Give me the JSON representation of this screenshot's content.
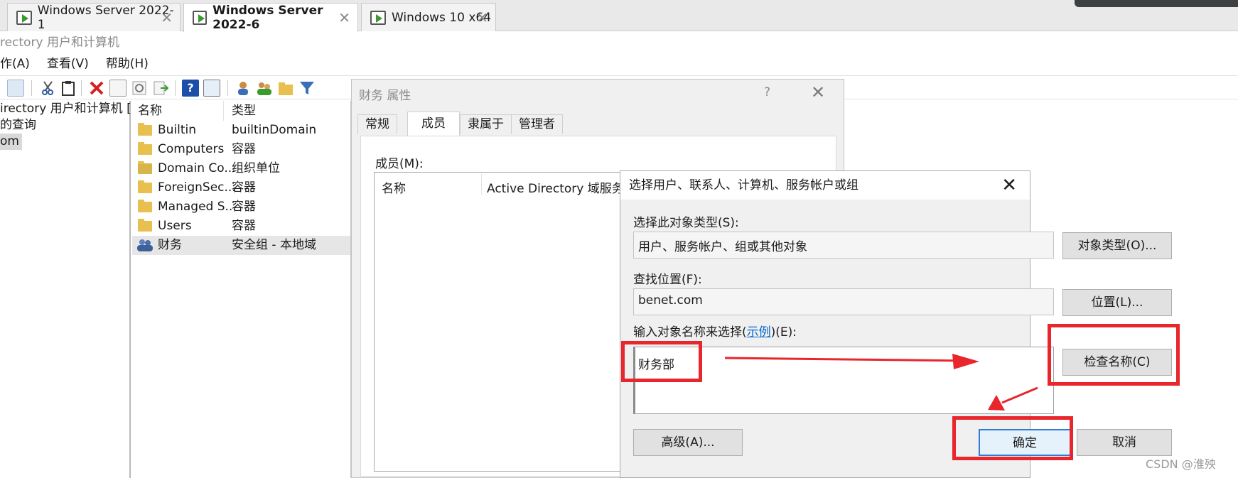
{
  "vm_tabs": [
    {
      "label": "Windows Server 2022-1",
      "active": false
    },
    {
      "label": "Windows Server 2022-6",
      "active": true
    },
    {
      "label": "Windows 10 x64",
      "active": false
    }
  ],
  "tab_close_glyph": "✕",
  "app_title": "rectory 用户和计算机",
  "menu": [
    "作(A)",
    "查看(V)",
    "帮助(H)"
  ],
  "tree": {
    "items": [
      "irectory 用户和计算机 [",
      "的查询",
      "om"
    ]
  },
  "list": {
    "columns": {
      "name": "名称",
      "type": "类型"
    },
    "rows": [
      {
        "name": "Builtin",
        "type": "builtinDomain",
        "icon": "folder-icon"
      },
      {
        "name": "Computers",
        "type": "容器",
        "icon": "folder-icon"
      },
      {
        "name": "Domain Co...",
        "type": "组织单位",
        "icon": "ou-folder-icon"
      },
      {
        "name": "ForeignSec...",
        "type": "容器",
        "icon": "folder-icon"
      },
      {
        "name": "Managed S...",
        "type": "容器",
        "icon": "folder-icon"
      },
      {
        "name": "Users",
        "type": "容器",
        "icon": "folder-icon"
      },
      {
        "name": "财务",
        "type": "安全组 - 本地域",
        "icon": "group-icon"
      }
    ]
  },
  "properties": {
    "title": "财务 属性",
    "help": "?",
    "close": "✕",
    "tabs": [
      "常规",
      "成员",
      "隶属于",
      "管理者"
    ],
    "active_tab": "成员",
    "members_label": "成员(M):",
    "col_name": "名称",
    "col_folder": "Active Directory 域服务"
  },
  "select_dialog": {
    "title": "选择用户、联系人、计算机、服务帐户或组",
    "close": "✕",
    "object_type_label": "选择此对象类型(S):",
    "object_type_value": "用户、服务帐户、组或其他对象",
    "object_type_button": "对象类型(O)...",
    "location_label": "查找位置(F):",
    "location_value": "benet.com",
    "location_button": "位置(L)...",
    "enter_names_prefix": "输入对象名称来选择(",
    "enter_names_link": "示例",
    "enter_names_suffix": ")(E):",
    "names_value": "财务部",
    "check_names_button": "检查名称(C)",
    "advanced_button": "高级(A)...",
    "ok_button": "确定",
    "cancel_button": "取消"
  },
  "annotation_color": "#e8262c",
  "watermark": "CSDN @淮殃"
}
